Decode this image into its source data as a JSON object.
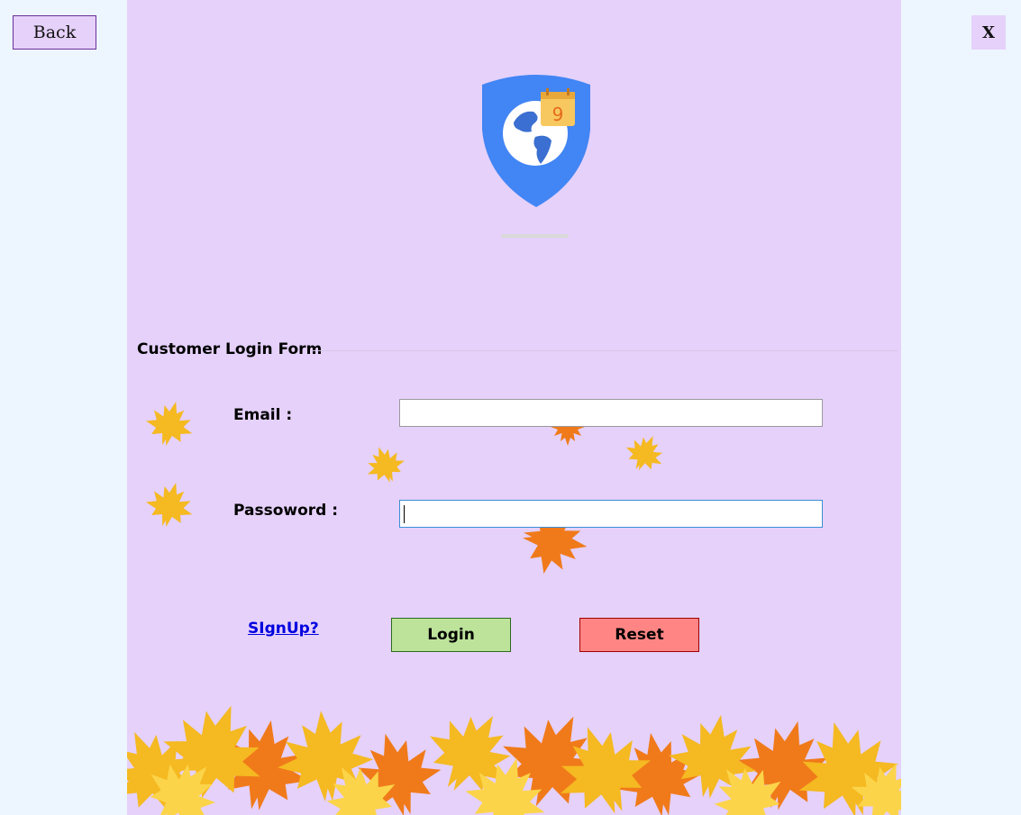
{
  "window": {
    "back_label": "Back",
    "close_label": "X"
  },
  "form": {
    "title": "Customer Login Form",
    "email_label": "Email :",
    "email_value": "",
    "password_label": "Passoword :",
    "password_value": "",
    "signup_link": "SIgnUp?",
    "login_button": "Login",
    "reset_button": "Reset"
  },
  "logo": {
    "calendar_number": "9"
  },
  "colors": {
    "panel_bg": "#e5d1fa",
    "page_bg": "#edf6ff",
    "login_bg": "#bde39b",
    "reset_bg": "#ff8585",
    "shield_blue": "#4285f4",
    "leaf_yellow": "#f5b921",
    "leaf_orange": "#f07a1a"
  },
  "icons": [
    "maple-leaf-icon",
    "shield-globe-logo",
    "calendar-icon"
  ]
}
